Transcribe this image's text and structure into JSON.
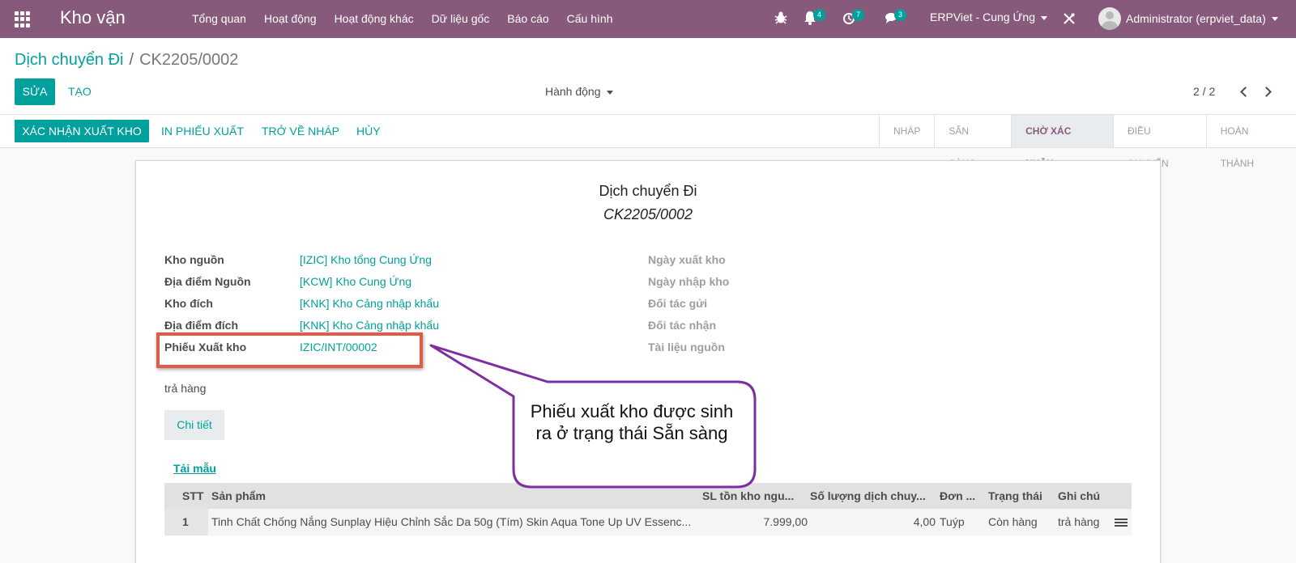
{
  "navbar": {
    "brand": "Kho vận",
    "menu": [
      "Tổng quan",
      "Hoạt động",
      "Hoạt động khác",
      "Dữ liệu gốc",
      "Báo cáo",
      "Cấu hình"
    ],
    "notifications": {
      "bell": "4",
      "activity": "7",
      "messages": "3"
    },
    "company": "ERPViet - Cung Ứng",
    "user": "Administrator (erpviet_data)",
    "color": "#875a7b"
  },
  "control": {
    "breadcrumb_parent": "Dịch chuyển Đi",
    "breadcrumb_current": "CK2205/0002",
    "edit_label": "SỬA",
    "create_label": "TẠO",
    "action_label": "Hành động",
    "pager": "2 / 2"
  },
  "statusbar": {
    "buttons": [
      "XÁC NHẬN XUẤT KHO",
      "IN PHIẾU XUẤT",
      "TRỞ VỀ NHÁP",
      "HỦY"
    ],
    "stages": [
      "NHÁP",
      "SẴN SÀNG",
      "CHỜ XÁC NHẬN",
      "ĐIỀU CHUYỂN",
      "HOÀN THÀNH"
    ],
    "active_stage": "CHỜ XÁC NHẬN"
  },
  "sheet": {
    "title": "Dịch chuyển Đi",
    "reference": "CK2205/0002",
    "left_fields": [
      {
        "label": "Kho nguồn",
        "value": "[IZIC] Kho tổng Cung Ứng"
      },
      {
        "label": "Địa điểm Nguồn",
        "value": "[KCW] Kho Cung Ứng"
      },
      {
        "label": "Kho đích",
        "value": "[KNK] Kho Cảng nhập khẩu"
      },
      {
        "label": "Địa điểm đích",
        "value": "[KNK] Kho Cảng nhập khẩu"
      },
      {
        "label": "Phiếu Xuất kho",
        "value": "IZIC/INT/00002"
      }
    ],
    "right_fields": [
      "Ngày xuất kho",
      "Ngày nhập kho",
      "Đối tác gửi",
      "Đối tác nhận",
      "Tài liệu nguồn"
    ],
    "note": "trả hàng",
    "detail_button": "Chi tiết",
    "download_template": "Tải mẫu",
    "table": {
      "headers": [
        "STT",
        "Sản phẩm",
        "SL tồn kho ngu...",
        "Số lượng dịch chuy...",
        "Đơn ...",
        "Trạng thái",
        "Ghi chú"
      ],
      "rows": [
        [
          "1",
          "Tinh Chất Chống Nắng Sunplay Hiệu Chỉnh Sắc Da 50g (Tím) Skin Aqua Tone Up UV Essenc...",
          "7.999,00",
          "4,00",
          "Tuýp",
          "Còn hàng",
          "trả hàng"
        ]
      ]
    }
  },
  "annotation": {
    "callout_text": "Phiếu xuất kho được sinh ra ở trạng thái Sẵn sàng",
    "box_color": "#e25a45",
    "callout_color": "#7b2fa0"
  }
}
